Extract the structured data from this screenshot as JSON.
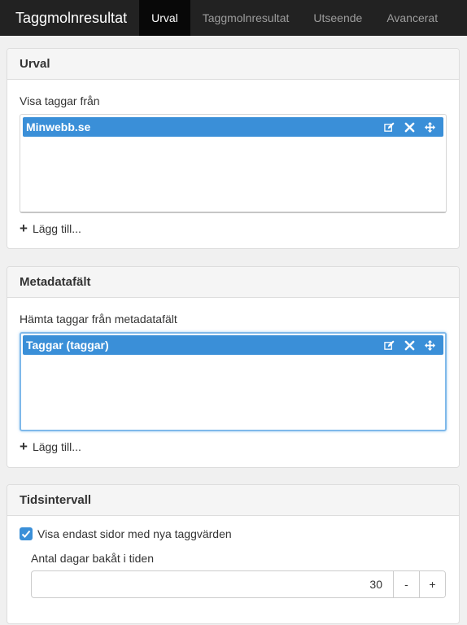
{
  "navbar": {
    "brand": "Taggmolnresultat",
    "tabs": [
      {
        "label": "Urval",
        "active": true
      },
      {
        "label": "Taggmolnresultat",
        "active": false
      },
      {
        "label": "Utseende",
        "active": false
      },
      {
        "label": "Avancerat",
        "active": false
      }
    ]
  },
  "urval": {
    "heading": "Urval",
    "field_label": "Visa taggar från",
    "items": [
      {
        "label": "Minwebb.se"
      }
    ],
    "add_label": "Lägg till..."
  },
  "metadata": {
    "heading": "Metadatafält",
    "field_label": "Hämta taggar från metadatafält",
    "items": [
      {
        "label": "Taggar (taggar)"
      }
    ],
    "add_label": "Lägg till..."
  },
  "tidsintervall": {
    "heading": "Tidsintervall",
    "checkbox_label": "Visa endast sidor med nya taggvärden",
    "checkbox_checked": true,
    "days_label": "Antal dagar bakåt i tiden",
    "days_value": "30",
    "minus_label": "-",
    "plus_label": "+"
  },
  "colors": {
    "navbar_bg": "#222222",
    "active_tab_bg": "#080808",
    "item_blue": "#3a8fd8",
    "focus_border": "#7fb9ea"
  },
  "icons": [
    "edit-icon",
    "remove-icon",
    "move-icon",
    "plus-icon",
    "checkmark-icon"
  ]
}
